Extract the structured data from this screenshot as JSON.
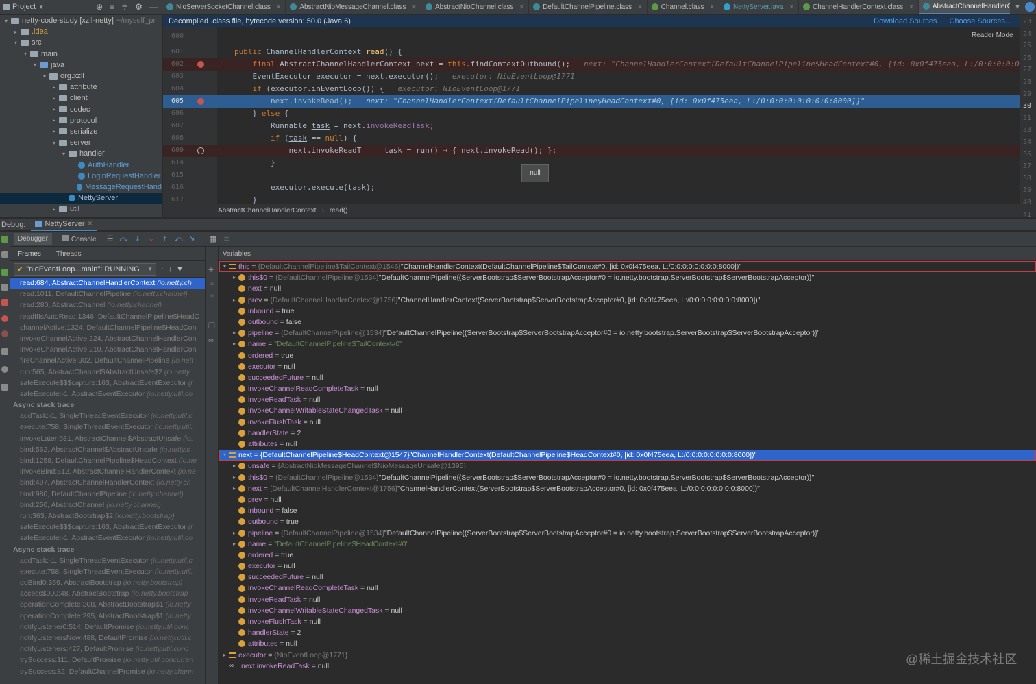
{
  "project_head": {
    "label": "Project"
  },
  "tabs": [
    {
      "label": "NioServerSocketChannel.class",
      "kind": "class"
    },
    {
      "label": "AbstractNioMessageChannel.class",
      "kind": "class"
    },
    {
      "label": "AbstractNioChannel.class",
      "kind": "class"
    },
    {
      "label": "DefaultChannelPipeline.class",
      "kind": "class"
    },
    {
      "label": "Channel.class",
      "kind": "green"
    },
    {
      "label": "NettyServer.java",
      "kind": "java"
    },
    {
      "label": "ChannelHandlerContext.class",
      "kind": "green"
    },
    {
      "label": "AbstractChannelHandlerContext.class",
      "kind": "class",
      "active": true
    }
  ],
  "tree": [
    {
      "label": "netty-code-study [xzll-netty]",
      "extra": "~/myself_pr",
      "depth": 0,
      "arrow": "▾",
      "kind": "folder"
    },
    {
      "label": ".idea",
      "depth": 1,
      "arrow": "▸",
      "kind": "idea"
    },
    {
      "label": "src",
      "depth": 1,
      "arrow": "▾",
      "kind": "folder"
    },
    {
      "label": "main",
      "depth": 2,
      "arrow": "▾",
      "kind": "folder"
    },
    {
      "label": "java",
      "depth": 3,
      "arrow": "▾",
      "kind": "blue"
    },
    {
      "label": "org.xzll",
      "depth": 4,
      "arrow": "▾",
      "kind": "folder"
    },
    {
      "label": "attribute",
      "depth": 5,
      "arrow": "▸",
      "kind": "folder"
    },
    {
      "label": "client",
      "depth": 5,
      "arrow": "▸",
      "kind": "folder"
    },
    {
      "label": "codec",
      "depth": 5,
      "arrow": "▸",
      "kind": "folder"
    },
    {
      "label": "protocol",
      "depth": 5,
      "arrow": "▸",
      "kind": "folder"
    },
    {
      "label": "serialize",
      "depth": 5,
      "arrow": "▸",
      "kind": "folder"
    },
    {
      "label": "server",
      "depth": 5,
      "arrow": "▾",
      "kind": "folder"
    },
    {
      "label": "handler",
      "depth": 6,
      "arrow": "▾",
      "kind": "folder"
    },
    {
      "label": "AuthHandler",
      "depth": 7,
      "arrow": "",
      "kind": "class"
    },
    {
      "label": "LoginRequestHandler",
      "depth": 7,
      "arrow": "",
      "kind": "class"
    },
    {
      "label": "MessageRequestHand",
      "depth": 7,
      "arrow": "",
      "kind": "class"
    },
    {
      "label": "NettyServer",
      "depth": 6,
      "arrow": "",
      "kind": "class",
      "selected": true
    },
    {
      "label": "util",
      "depth": 5,
      "arrow": "▸",
      "kind": "folder"
    }
  ],
  "decompiled": {
    "notice": "Decompiled .class file, bytecode version: 50.0 (Java 6)",
    "download": "Download Sources",
    "choose": "Choose Sources..."
  },
  "reader_mode": "Reader Mode",
  "code": {
    "lines": [
      {
        "num": "600",
        "html": "",
        "kind": ""
      },
      {
        "num": "601",
        "kind": "",
        "parts": [
          [
            "kw",
            "public "
          ],
          [
            "",
            "ChannelHandlerContext "
          ],
          [
            "fn",
            "read"
          ],
          [
            "",
            "() {"
          ]
        ]
      },
      {
        "num": "602",
        "kind": "bp",
        "parts": [
          [
            "",
            "    "
          ],
          [
            "kw",
            "final "
          ],
          [
            "",
            "AbstractChannelHandlerContext next = "
          ],
          [
            "kw",
            "this"
          ],
          [
            "",
            ".findContextOutbound();   "
          ],
          [
            "hint",
            "next: \"ChannelHandlerContext(DefaultChannelPipeline$HeadContext#0, [id: 0x0f475eea, L:/0:0:0:0:0:0:0:0"
          ]
        ]
      },
      {
        "num": "603",
        "kind": "",
        "parts": [
          [
            "",
            "    EventExecutor executor = next.executor();   "
          ],
          [
            "hint",
            "executor: NioEventLoop@1771"
          ]
        ]
      },
      {
        "num": "604",
        "kind": "",
        "parts": [
          [
            "",
            "    "
          ],
          [
            "kw",
            "if "
          ],
          [
            "",
            "(executor.inEventLoop()) {   "
          ],
          [
            "hint",
            "executor: NioEventLoop@1771"
          ]
        ]
      },
      {
        "num": "605",
        "kind": "cur",
        "parts": [
          [
            "",
            "        next.invokeRead();   "
          ],
          [
            "hint",
            "next: \"ChannelHandlerContext(DefaultChannelPipeline$HeadContext#0, [id: 0x0f475eea, L:/0:0:0:0:0:0:0:0:8000]]\""
          ]
        ]
      },
      {
        "num": "606",
        "kind": "",
        "parts": [
          [
            "",
            "    } "
          ],
          [
            "kw",
            "else "
          ],
          [
            "",
            "{"
          ]
        ]
      },
      {
        "num": "607",
        "kind": "",
        "parts": [
          [
            "",
            "        Runnable "
          ],
          [
            "ul",
            "task"
          ],
          [
            "",
            " = next."
          ],
          [
            "purple",
            "invokeReadTask"
          ],
          [
            "kw",
            ";"
          ]
        ]
      },
      {
        "num": "608",
        "kind": "",
        "parts": [
          [
            "",
            "        "
          ],
          [
            "kw",
            "if "
          ],
          [
            "",
            "("
          ],
          [
            "ul",
            "task"
          ],
          [
            "",
            " == "
          ],
          [
            "kw",
            "null"
          ],
          [
            "",
            ") {"
          ]
        ]
      },
      {
        "num": "609",
        "kind": "bp2",
        "parts": [
          [
            "",
            "            next.invokeReadT     "
          ],
          [
            "ul",
            "task"
          ],
          [
            "",
            " = run() → { "
          ],
          [
            "ul",
            "next"
          ],
          [
            "",
            ".invokeRead(); };"
          ]
        ]
      },
      {
        "num": "614",
        "kind": "",
        "parts": [
          [
            "",
            "        }"
          ]
        ]
      },
      {
        "num": "615",
        "kind": "",
        "parts": [
          [
            "",
            ""
          ]
        ]
      },
      {
        "num": "616",
        "kind": "",
        "parts": [
          [
            "",
            "        executor.execute("
          ],
          [
            "ul",
            "task"
          ],
          [
            "",
            ");"
          ]
        ]
      },
      {
        "num": "617",
        "kind": "",
        "parts": [
          [
            "",
            "    }"
          ]
        ]
      }
    ],
    "tooltip": "null",
    "right_numbers": [
      "23",
      "24",
      "25",
      "26",
      "27",
      "28",
      "29",
      "30",
      "31",
      "33",
      "34",
      "36",
      "37",
      "38",
      "39",
      "40",
      "41"
    ]
  },
  "breadcrumb": [
    "AbstractChannelHandlerContext",
    "read()"
  ],
  "debug": {
    "label": "Debug:",
    "session": "NettyServer",
    "debugger_tab": "Debugger",
    "console_tab": "Console",
    "frames_tab": "Frames",
    "threads_tab": "Threads",
    "thread": "\"nioEventLoop...main\": RUNNING",
    "variables_title": "Variables"
  },
  "frames": [
    {
      "text": "read:684, AbstractChannelHandlerContext ",
      "pkg": "(io.netty.ch",
      "sel": true
    },
    {
      "text": "read:1011, DefaultChannelPipeline ",
      "pkg": "(io.netty.channel)"
    },
    {
      "text": "read:280, AbstractChannel ",
      "pkg": "(io.netty.channel)"
    },
    {
      "text": "readIfIsAutoRead:1346, DefaultChannelPipeline$HeadC",
      "pkg": ""
    },
    {
      "text": "channelActive:1324, DefaultChannelPipeline$HeadCon",
      "pkg": ""
    },
    {
      "text": "invokeChannelActive:224, AbstractChannelHandlerCon",
      "pkg": ""
    },
    {
      "text": "invokeChannelActive:210, AbstractChannelHandlerCon",
      "pkg": ""
    },
    {
      "text": "fireChannelActive:902, DefaultChannelPipeline ",
      "pkg": "(io.nett"
    },
    {
      "text": "run:565, AbstractChannel$AbstractUnsafe$2 ",
      "pkg": "(io.netty."
    },
    {
      "text": "safeExecute$$$capture:163, AbstractEventExecutor ",
      "pkg": "(i"
    },
    {
      "text": "safeExecute:-1, AbstractEventExecutor ",
      "pkg": "(io.netty.util.co"
    },
    {
      "text": "Async stack trace",
      "hdr": true
    },
    {
      "text": "addTask:-1, SingleThreadEventExecutor ",
      "pkg": "(io.netty.util.c"
    },
    {
      "text": "execute:758, SingleThreadEventExecutor ",
      "pkg": "(io.netty.util."
    },
    {
      "text": "invokeLater:931, AbstractChannel$AbstractUnsafe ",
      "pkg": "(io."
    },
    {
      "text": "bind:562, AbstractChannel$AbstractUnsafe ",
      "pkg": "(io.netty.c"
    },
    {
      "text": "bind:1258, DefaultChannelPipeline$HeadContext ",
      "pkg": "(io.ne"
    },
    {
      "text": "invokeBind:512, AbstractChannelHandlerContext ",
      "pkg": "(io.ne"
    },
    {
      "text": "bind:497, AbstractChannelHandlerContext ",
      "pkg": "(io.netty.ch"
    },
    {
      "text": "bind:980, DefaultChannelPipeline ",
      "pkg": "(io.netty.channel)"
    },
    {
      "text": "bind:250, AbstractChannel ",
      "pkg": "(io.netty.channel)"
    },
    {
      "text": "run:363, AbstractBootstrap$2 ",
      "pkg": "(io.netty.bootstrap)"
    },
    {
      "text": "safeExecute$$$capture:163, AbstractEventExecutor ",
      "pkg": "(i"
    },
    {
      "text": "safeExecute:-1, AbstractEventExecutor ",
      "pkg": "(io.netty.util.co"
    },
    {
      "text": "Async stack trace",
      "hdr": true
    },
    {
      "text": "addTask:-1, SingleThreadEventExecutor ",
      "pkg": "(io.netty.util.c"
    },
    {
      "text": "execute:758, SingleThreadEventExecutor ",
      "pkg": "(io.netty.util."
    },
    {
      "text": "doBind0:359, AbstractBootstrap ",
      "pkg": "(io.netty.bootstrap)"
    },
    {
      "text": "access$000:48, AbstractBootstrap ",
      "pkg": "(io.netty.bootstrap"
    },
    {
      "text": "operationComplete:308, AbstractBootstrap$1 ",
      "pkg": "(io.netty"
    },
    {
      "text": "operationComplete:295, AbstractBootstrap$1 ",
      "pkg": "(io.netty"
    },
    {
      "text": "notifyListener0:514, DefaultPromise ",
      "pkg": "(io.netty.util.conc"
    },
    {
      "text": "notifyListenersNow:488, DefaultPromise ",
      "pkg": "(io.netty.util.c"
    },
    {
      "text": "notifyListeners:427, DefaultPromise ",
      "pkg": "(io.netty.util.conc"
    },
    {
      "text": "trySuccess:111, DefaultPromise ",
      "pkg": "(io.netty.util.concurren"
    },
    {
      "text": "trySuccess:82, DefaultChannelPromise ",
      "pkg": "(io.netty.chann"
    }
  ],
  "variables": [
    {
      "d": 0,
      "ex": "▾",
      "ic": "lines",
      "nm": "this",
      "ty": "{DefaultChannelPipeline$TailContext@1546}",
      "val": "\"ChannelHandlerContext(DefaultChannelPipeline$TailContext#0, [id: 0x0f475eea, L:/0:0:0:0:0:0:0:0:8000])\"",
      "box": true
    },
    {
      "d": 1,
      "ex": "▸",
      "ic": "f",
      "nm": "this$0",
      "ty": "{DefaultChannelPipeline@1534}",
      "val": "\"DefaultChannelPipeline{(ServerBootstrap$ServerBootstrapAcceptor#0 = io.netty.bootstrap.ServerBootstrap$ServerBootstrapAcceptor)}\""
    },
    {
      "d": 1,
      "ex": "",
      "ic": "f",
      "nm": "next",
      "ty": "",
      "val": "null"
    },
    {
      "d": 1,
      "ex": "▸",
      "ic": "f",
      "nm": "prev",
      "ty": "{DefaultChannelHandlerContext@1756}",
      "val": "\"ChannelHandlerContext(ServerBootstrap$ServerBootstrapAcceptor#0, [id: 0x0f475eea, L:/0:0:0:0:0:0:0:0:8000])\""
    },
    {
      "d": 1,
      "ex": "",
      "ic": "f",
      "nm": "inbound",
      "ty": "",
      "val": "true"
    },
    {
      "d": 1,
      "ex": "",
      "ic": "f",
      "nm": "outbound",
      "ty": "",
      "val": "false"
    },
    {
      "d": 1,
      "ex": "▸",
      "ic": "f",
      "nm": "pipeline",
      "ty": "{DefaultChannelPipeline@1534}",
      "val": "\"DefaultChannelPipeline{(ServerBootstrap$ServerBootstrapAcceptor#0 = io.netty.bootstrap.ServerBootstrap$ServerBootstrapAcceptor)}\""
    },
    {
      "d": 1,
      "ex": "▸",
      "ic": "f",
      "nm": "name",
      "ty": "",
      "val": "\"DefaultChannelPipeline$TailContext#0\"",
      "str": true
    },
    {
      "d": 1,
      "ex": "",
      "ic": "f",
      "nm": "ordered",
      "ty": "",
      "val": "true"
    },
    {
      "d": 1,
      "ex": "",
      "ic": "f",
      "nm": "executor",
      "ty": "",
      "val": "null"
    },
    {
      "d": 1,
      "ex": "",
      "ic": "f",
      "nm": "succeededFuture",
      "ty": "",
      "val": "null"
    },
    {
      "d": 1,
      "ex": "",
      "ic": "f",
      "nm": "invokeChannelReadCompleteTask",
      "ty": "",
      "val": "null"
    },
    {
      "d": 1,
      "ex": "",
      "ic": "f",
      "nm": "invokeReadTask",
      "ty": "",
      "val": "null"
    },
    {
      "d": 1,
      "ex": "",
      "ic": "f",
      "nm": "invokeChannelWritableStateChangedTask",
      "ty": "",
      "val": "null"
    },
    {
      "d": 1,
      "ex": "",
      "ic": "f",
      "nm": "invokeFlushTask",
      "ty": "",
      "val": "null"
    },
    {
      "d": 1,
      "ex": "",
      "ic": "f",
      "nm": "handlerState",
      "ty": "",
      "val": "2"
    },
    {
      "d": 1,
      "ex": "",
      "ic": "f",
      "nm": "attributes",
      "ty": "",
      "val": "null"
    },
    {
      "d": 0,
      "ex": "▾",
      "ic": "lines",
      "nm": "next",
      "ty": "{DefaultChannelPipeline$HeadContext@1547}",
      "val": "\"ChannelHandlerContext(DefaultChannelPipeline$HeadContext#0, [id: 0x0f475eea, L:/0:0:0:0:0:0:0:0:8000])\"",
      "sel": true,
      "box": true
    },
    {
      "d": 1,
      "ex": "▸",
      "ic": "f",
      "nm": "unsafe",
      "ty": "{AbstractNioMessageChannel$NioMessageUnsafe@1395}",
      "val": ""
    },
    {
      "d": 1,
      "ex": "▸",
      "ic": "f",
      "nm": "this$0",
      "ty": "{DefaultChannelPipeline@1534}",
      "val": "\"DefaultChannelPipeline{(ServerBootstrap$ServerBootstrapAcceptor#0 = io.netty.bootstrap.ServerBootstrap$ServerBootstrapAcceptor)}\""
    },
    {
      "d": 1,
      "ex": "▸",
      "ic": "f",
      "nm": "next",
      "ty": "{DefaultChannelHandlerContext@1756}",
      "val": "\"ChannelHandlerContext(ServerBootstrap$ServerBootstrapAcceptor#0, [id: 0x0f475eea, L:/0:0:0:0:0:0:0:0:8000])\""
    },
    {
      "d": 1,
      "ex": "",
      "ic": "f",
      "nm": "prev",
      "ty": "",
      "val": "null"
    },
    {
      "d": 1,
      "ex": "",
      "ic": "f",
      "nm": "inbound",
      "ty": "",
      "val": "false"
    },
    {
      "d": 1,
      "ex": "",
      "ic": "f",
      "nm": "outbound",
      "ty": "",
      "val": "true"
    },
    {
      "d": 1,
      "ex": "▸",
      "ic": "f",
      "nm": "pipeline",
      "ty": "{DefaultChannelPipeline@1534}",
      "val": "\"DefaultChannelPipeline{(ServerBootstrap$ServerBootstrapAcceptor#0 = io.netty.bootstrap.ServerBootstrap$ServerBootstrapAcceptor)}\""
    },
    {
      "d": 1,
      "ex": "▸",
      "ic": "f",
      "nm": "name",
      "ty": "",
      "val": "\"DefaultChannelPipeline$HeadContext#0\"",
      "str": true
    },
    {
      "d": 1,
      "ex": "",
      "ic": "f",
      "nm": "ordered",
      "ty": "",
      "val": "true"
    },
    {
      "d": 1,
      "ex": "",
      "ic": "f",
      "nm": "executor",
      "ty": "",
      "val": "null"
    },
    {
      "d": 1,
      "ex": "",
      "ic": "f",
      "nm": "succeededFuture",
      "ty": "",
      "val": "null"
    },
    {
      "d": 1,
      "ex": "",
      "ic": "f",
      "nm": "invokeChannelReadCompleteTask",
      "ty": "",
      "val": "null"
    },
    {
      "d": 1,
      "ex": "",
      "ic": "f",
      "nm": "invokeReadTask",
      "ty": "",
      "val": "null"
    },
    {
      "d": 1,
      "ex": "",
      "ic": "f",
      "nm": "invokeChannelWritableStateChangedTask",
      "ty": "",
      "val": "null"
    },
    {
      "d": 1,
      "ex": "",
      "ic": "f",
      "nm": "invokeFlushTask",
      "ty": "",
      "val": "null"
    },
    {
      "d": 1,
      "ex": "",
      "ic": "f",
      "nm": "handlerState",
      "ty": "",
      "val": "2"
    },
    {
      "d": 1,
      "ex": "",
      "ic": "f",
      "nm": "attributes",
      "ty": "",
      "val": "null"
    },
    {
      "d": 0,
      "ex": "▸",
      "ic": "lines",
      "nm": "executor",
      "ty": "{NioEventLoop@1771}",
      "val": ""
    },
    {
      "d": 0,
      "ex": "",
      "ic": "inf",
      "nm": "next.invokeReadTask",
      "ty": "",
      "val": "null"
    }
  ],
  "watermark": "@稀土掘金技术社区"
}
